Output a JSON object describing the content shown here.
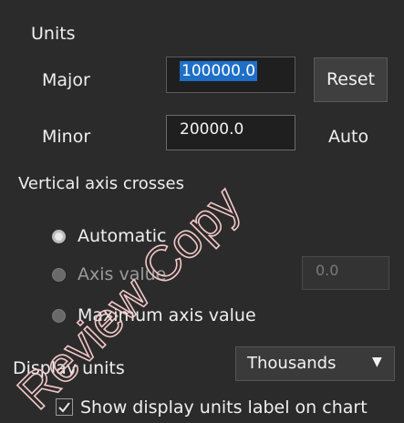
{
  "units": {
    "heading": "Units",
    "major_label": "Major",
    "major_value": "100000.0",
    "minor_label": "Minor",
    "minor_value": "20000.0",
    "reset_label": "Reset",
    "auto_label": "Auto"
  },
  "vertical_axis": {
    "heading": "Vertical axis crosses",
    "options": [
      {
        "label": "Automatic",
        "selected": true
      },
      {
        "label": "Axis value",
        "selected": false
      },
      {
        "label": "Maximum axis value",
        "selected": false
      }
    ],
    "axis_value": "0.0"
  },
  "display_units": {
    "label": "Display units",
    "selected": "Thousands",
    "show_label_checkbox": "Show display units label on chart",
    "show_label_checked": true
  },
  "watermark": {
    "text": "Review Copy",
    "color": "#f4c9c9"
  }
}
